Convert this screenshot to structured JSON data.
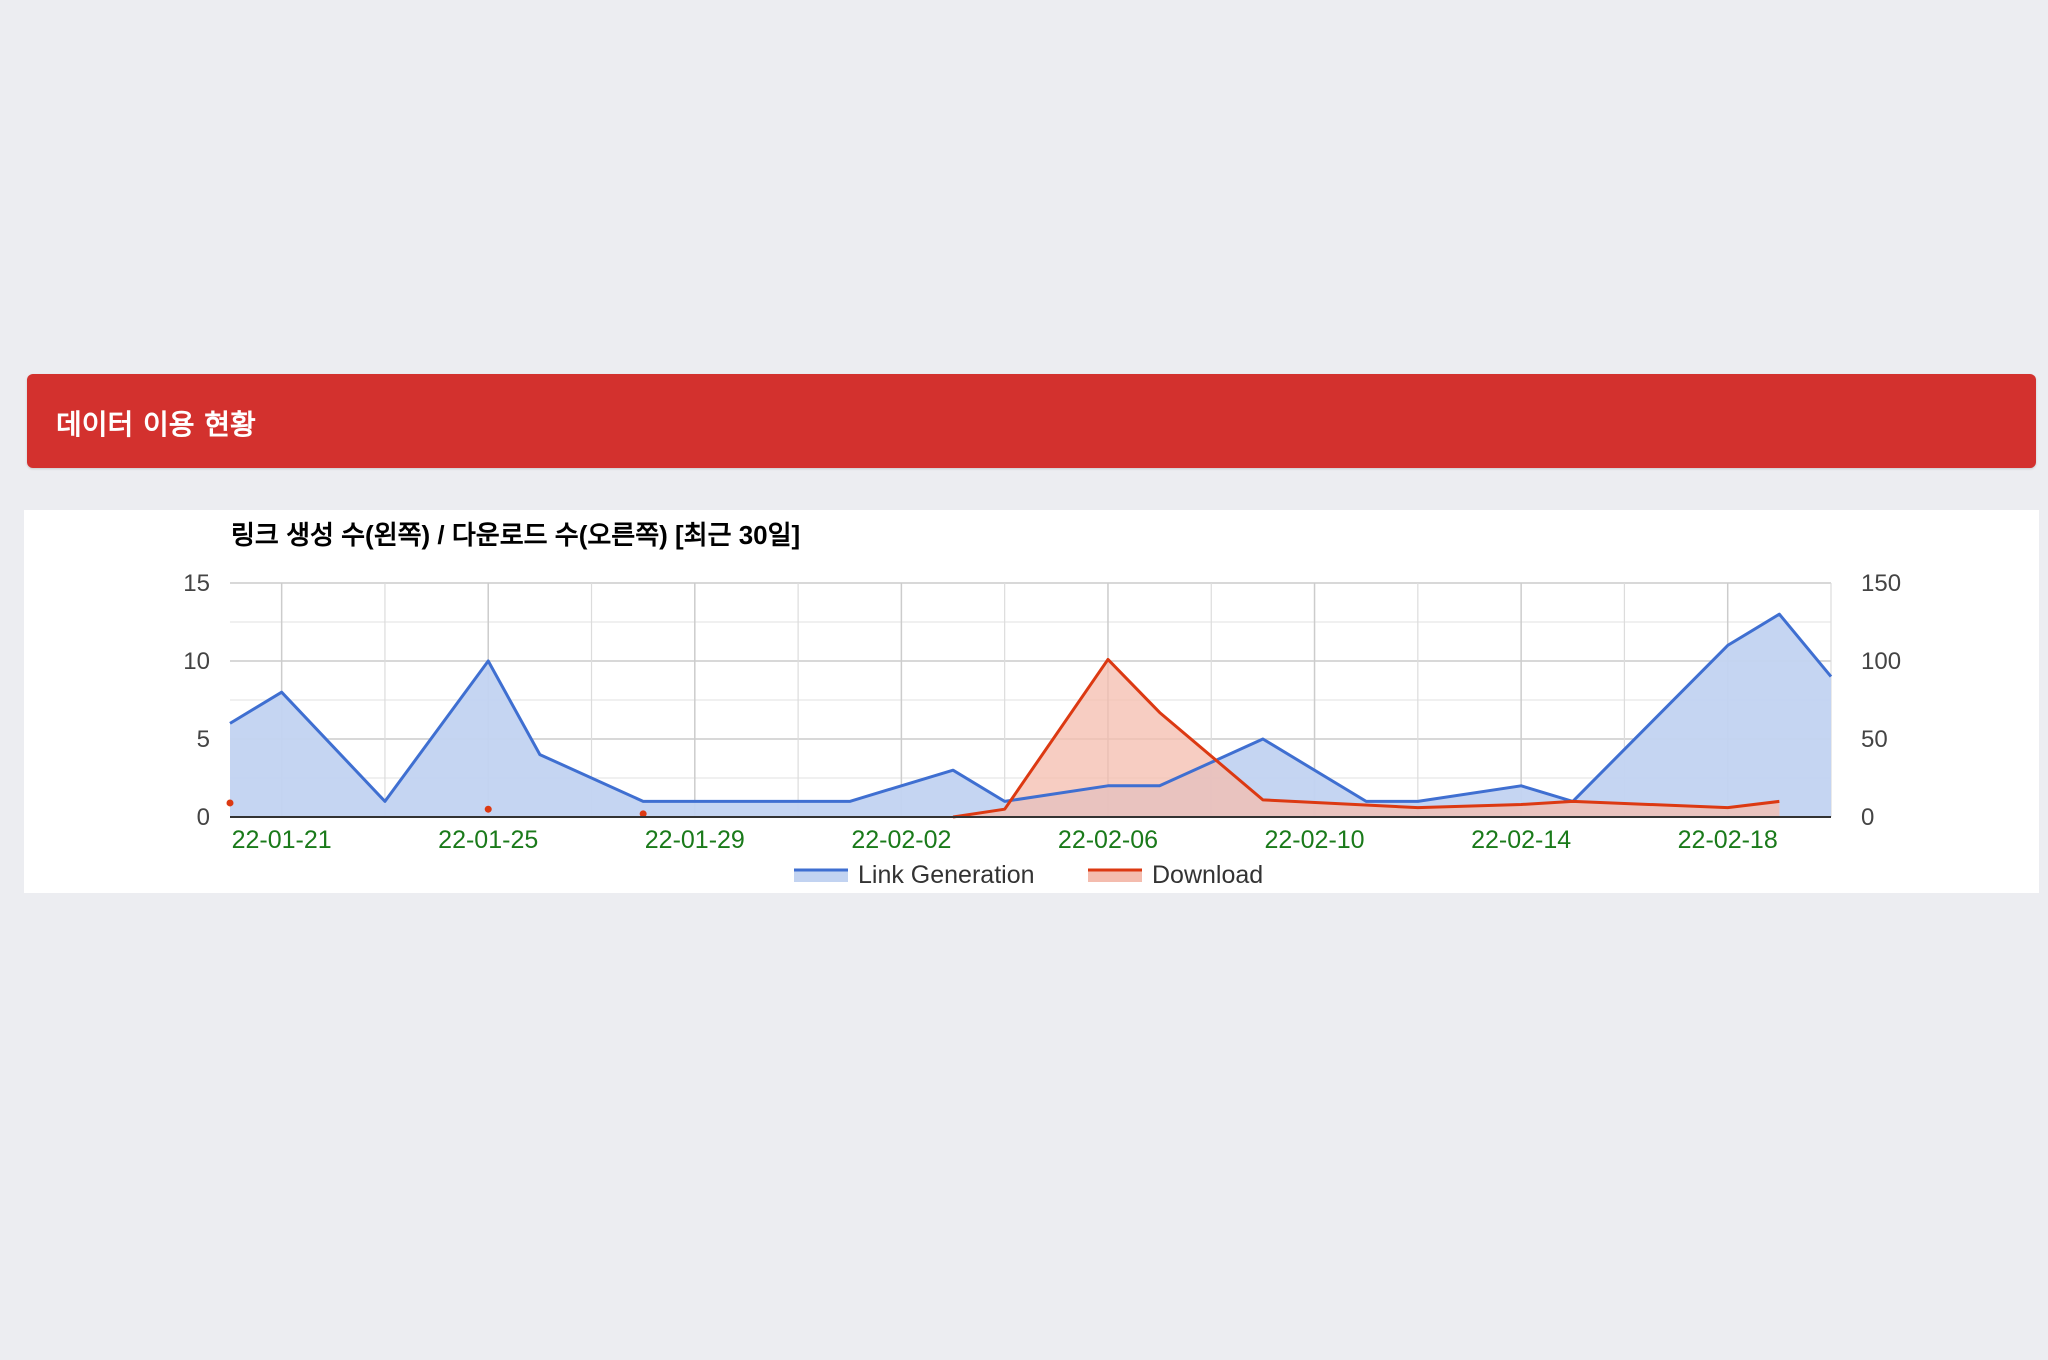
{
  "header": {
    "title": "데이터 이용 현황"
  },
  "chart_data": {
    "type": "area",
    "title": "링크 생성 수(왼쪽) / 다운로드 수(오른쪽) [최근 30일]",
    "x_tick_labels": [
      "22-01-21",
      "22-01-25",
      "22-01-29",
      "22-02-02",
      "22-02-06",
      "22-02-10",
      "22-02-14",
      "22-02-18"
    ],
    "y_left": {
      "ylim": [
        0,
        15
      ],
      "ticks": [
        "0",
        "5",
        "10",
        "15"
      ]
    },
    "y_right": {
      "ylim": [
        0,
        150
      ],
      "ticks": [
        "0",
        "50",
        "100",
        "150"
      ]
    },
    "grid": true,
    "legend_position": "bottom",
    "series": [
      {
        "name": "Link Generation",
        "axis": "left",
        "color": "#3f6fd1",
        "fill": "#c2d3f1",
        "points": [
          [
            "22-01-20",
            6
          ],
          [
            "22-01-21",
            8
          ],
          [
            "22-01-23",
            1
          ],
          [
            "22-01-25",
            10
          ],
          [
            "22-01-26",
            4
          ],
          [
            "22-01-28",
            1
          ],
          [
            "22-02-01",
            1
          ],
          [
            "22-02-03",
            3
          ],
          [
            "22-02-04",
            1
          ],
          [
            "22-02-06",
            2
          ],
          [
            "22-02-07",
            2
          ],
          [
            "22-02-09",
            5
          ],
          [
            "22-02-11",
            1
          ],
          [
            "22-02-12",
            1
          ],
          [
            "22-02-14",
            2
          ],
          [
            "22-02-15",
            1
          ],
          [
            "22-02-18",
            11
          ],
          [
            "22-02-19",
            13
          ],
          [
            "22-02-20",
            9
          ]
        ]
      },
      {
        "name": "Download",
        "axis": "right",
        "color": "#dc3912",
        "fill": "#f4bcae",
        "points": [
          [
            "22-02-03",
            0
          ],
          [
            "22-02-04",
            5
          ],
          [
            "22-02-06",
            101
          ],
          [
            "22-02-07",
            67
          ],
          [
            "22-02-09",
            11
          ],
          [
            "22-02-12",
            6
          ],
          [
            "22-02-14",
            8
          ],
          [
            "22-02-15",
            10
          ],
          [
            "22-02-18",
            6
          ],
          [
            "22-02-19",
            10
          ]
        ],
        "isolated_points": [
          [
            "22-01-20",
            9
          ],
          [
            "22-01-25",
            5
          ],
          [
            "22-01-28",
            2
          ]
        ]
      }
    ]
  }
}
